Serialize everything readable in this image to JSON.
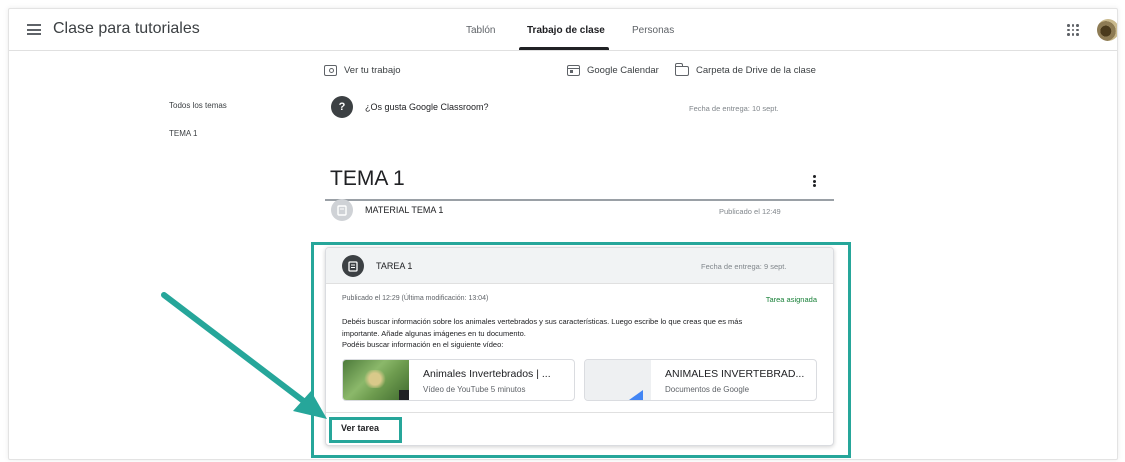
{
  "header": {
    "class_title": "Clase para tutoriales",
    "tabs": [
      {
        "label": "Tablón"
      },
      {
        "label": "Trabajo de clase",
        "active": true
      },
      {
        "label": "Personas"
      }
    ]
  },
  "actions": {
    "view_work": "Ver tu trabajo",
    "calendar": "Google Calendar",
    "drive_folder": "Carpeta de Drive de la clase"
  },
  "sidebar": {
    "items": [
      "Todos los temas",
      "TEMA 1"
    ]
  },
  "question": {
    "icon": "?",
    "title": "¿Os gusta Google Classroom?",
    "due": "Fecha de entrega: 10 sept."
  },
  "topic": {
    "title": "TEMA 1"
  },
  "material": {
    "title": "MATERIAL TEMA 1",
    "published": "Publicado el 12:49"
  },
  "assignment": {
    "title": "TAREA 1",
    "due": "Fecha de entrega: 9 sept.",
    "meta": "Publicado el 12:29 (Última modificación: 13:04)",
    "status": "Tarea asignada",
    "description_lines": [
      "Debéis buscar información sobre los animales vertebrados y sus características. Luego escribe lo que creas que es más",
      "importante. Añade algunas imágenes en tu documento.",
      "Podéis buscar información en el siguiente vídeo:"
    ],
    "attachments": [
      {
        "title": "Animales Invertebrados | ...",
        "subtitle": "Vídeo de YouTube   5 minutos"
      },
      {
        "title": "ANIMALES INVERTEBRAD...",
        "subtitle": "Documentos de Google"
      }
    ],
    "view_button": "Ver tarea"
  },
  "colors": {
    "annotation_teal": "#26a69a",
    "status_green": "#188038",
    "header_gray": "#f1f3f4"
  }
}
